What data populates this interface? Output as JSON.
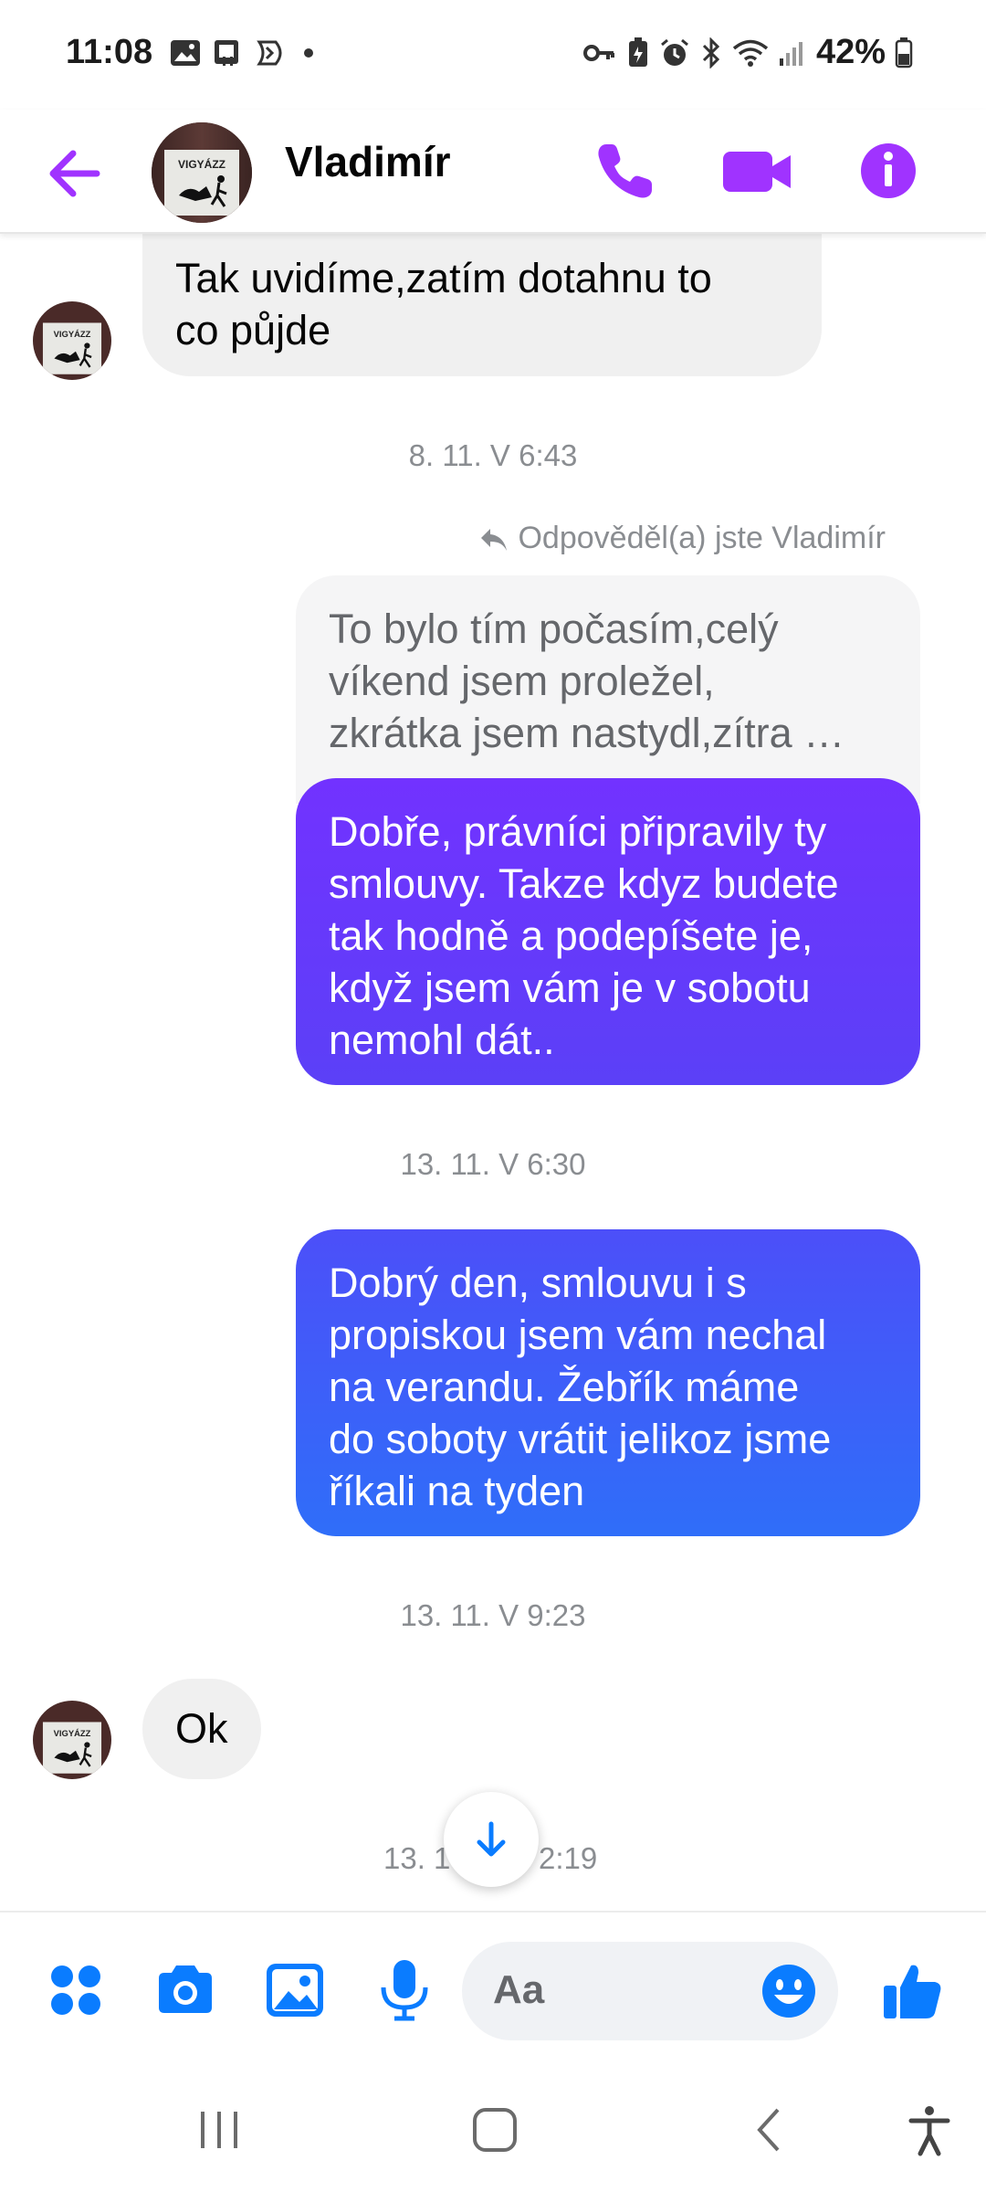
{
  "status_bar": {
    "time": "11:08",
    "battery": "42%",
    "left_icons": [
      "gallery-icon",
      "sim-icon",
      "app-icon",
      "dot-icon"
    ],
    "right_icons": [
      "key-icon",
      "battery-saver-icon",
      "alarm-icon",
      "bluetooth-icon",
      "wifi-icon",
      "signal-icon"
    ]
  },
  "header": {
    "contact_name": "Vladimír",
    "avatar_text": "VIGYÁZZ",
    "accent": "#a033ff"
  },
  "conversation": {
    "messages": [
      {
        "kind": "incoming",
        "text_lines": [
          "Tak uvidíme,zatím dotahnu to",
          "co půjde"
        ]
      },
      {
        "kind": "timestamp",
        "text": "8. 11. V 6:43"
      },
      {
        "kind": "reply_label",
        "text": "Odpověděl(a) jste Vladimír"
      },
      {
        "kind": "quoted",
        "text_lines": [
          "To bylo tím počasím,celý",
          "víkend jsem proležel,",
          "zkrátka jsem nastydl,zítra …"
        ]
      },
      {
        "kind": "outgoing",
        "text_lines": [
          "Dobře,  právníci připravily ty",
          "smlouvy. Takze kdyz budete",
          "tak hodně a podepíšete je,",
          "když jsem vám je v sobotu",
          "nemohl dát.."
        ]
      },
      {
        "kind": "timestamp",
        "text": "13. 11. V 6:30"
      },
      {
        "kind": "outgoing",
        "text_lines": [
          "Dobrý den,  smlouvu i s",
          "propiskou jsem vám nechal",
          "na verandu. Žebřík máme",
          "do soboty vrátit jelikoz jsme",
          "říkali na tyden"
        ]
      },
      {
        "kind": "timestamp",
        "text": "13. 11. V 9:23"
      },
      {
        "kind": "incoming",
        "text_lines": [
          "Ok"
        ]
      },
      {
        "kind": "timestamp_partial",
        "left": "13. 1",
        "right": "2:19"
      }
    ]
  },
  "composer": {
    "placeholder": "Aa",
    "buttons": [
      "menu-icon",
      "camera-icon",
      "gallery-icon",
      "microphone-icon",
      "emoji-icon",
      "like-icon"
    ],
    "color": "#0a7cff"
  },
  "navigation": {
    "buttons": [
      "recent-apps-icon",
      "home-icon",
      "back-icon",
      "accessibility-icon"
    ]
  }
}
